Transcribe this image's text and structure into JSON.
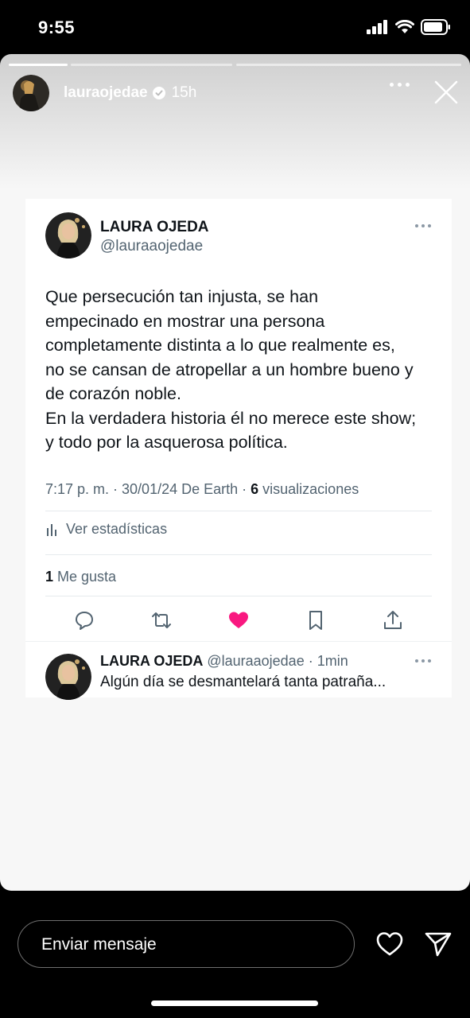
{
  "status_bar": {
    "time": "9:55"
  },
  "story": {
    "progress": [
      1.0,
      0.0
    ],
    "username": "lauraojedae",
    "time_ago": "15h"
  },
  "tweet": {
    "name": "LAURA OJEDA",
    "handle": "@lauraaojedae",
    "text_lines": [
      "Que persecución tan injusta, se han",
      "empecinado en mostrar una persona",
      "completamente distinta a lo que realmente es,",
      "no se cansan de atropellar a un hombre bueno y",
      "de corazón noble.",
      "En la verdadera historia él no merece este show;",
      "y todo por la asquerosa política."
    ],
    "meta_prefix": "7:17 p. m. · 30/01/24 De Earth · ",
    "views_count": "6",
    "views_label": " visualizaciones",
    "stats_label": "Ver estadísticas",
    "likes_count": "1",
    "likes_label": " Me gusta",
    "like_color": "#f91880"
  },
  "reply": {
    "name": "LAURA OJEDA",
    "handle_time": " @lauraaojedae · 1min",
    "text": "Algún día se desmantelará tanta patraña..."
  },
  "message_bar": {
    "placeholder": "Enviar mensaje"
  }
}
